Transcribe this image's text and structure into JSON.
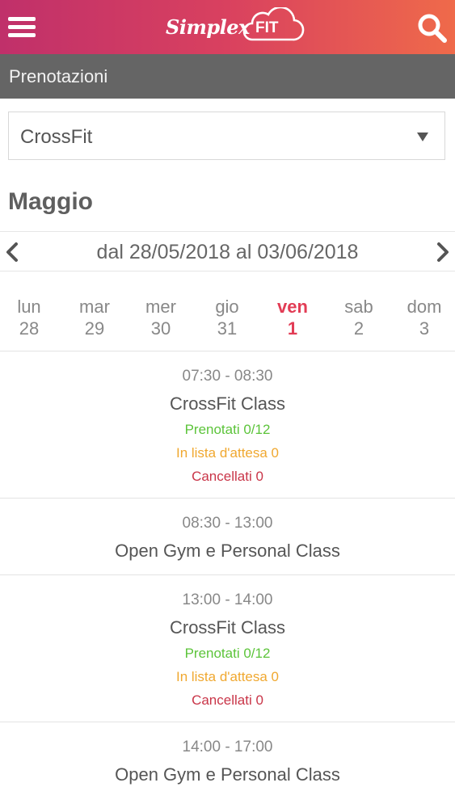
{
  "header": {
    "logo_text": "Simplex",
    "logo_badge": "FIT",
    "icons": {
      "menu": "hamburger-menu-icon",
      "search": "search-icon"
    },
    "colors": {
      "gradient_start": "#c0306a",
      "gradient_end": "#ef6a4a"
    }
  },
  "section": {
    "title": "Prenotazioni"
  },
  "filter": {
    "selected": "CrossFit"
  },
  "calendar": {
    "month": "Maggio",
    "range": "dal 28/05/2018 al 03/06/2018",
    "active_color": "#e23c55",
    "days": [
      {
        "name": "lun",
        "num": "28"
      },
      {
        "name": "mar",
        "num": "29"
      },
      {
        "name": "mer",
        "num": "30"
      },
      {
        "name": "gio",
        "num": "31"
      },
      {
        "name": "ven",
        "num": "1"
      },
      {
        "name": "sab",
        "num": "2"
      },
      {
        "name": "dom",
        "num": "3"
      }
    ],
    "active_day_index": 4
  },
  "sessions": [
    {
      "time": "07:30 - 08:30",
      "name": "CrossFit Class",
      "booked": "Prenotati 0/12",
      "waitlist": "In lista d'attesa 0",
      "cancelled": "Cancellati 0"
    },
    {
      "time": "08:30 - 13:00",
      "name": "Open Gym e Personal Class"
    },
    {
      "time": "13:00 - 14:00",
      "name": "CrossFit Class",
      "booked": "Prenotati 0/12",
      "waitlist": "In lista d'attesa 0",
      "cancelled": "Cancellati 0"
    },
    {
      "time": "14:00 - 17:00",
      "name": "Open Gym e Personal Class"
    }
  ],
  "status_colors": {
    "booked": "#5cc43a",
    "waitlist": "#f0a830",
    "cancelled": "#c93548"
  }
}
